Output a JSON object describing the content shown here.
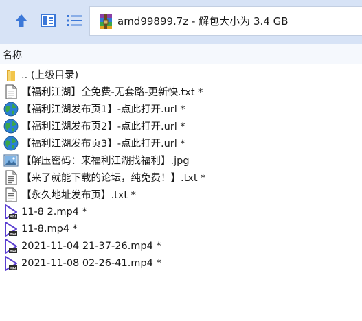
{
  "toolbar": {
    "up_icon": "up-arrow-icon",
    "view_icon": "view-mode-icon",
    "list_icon": "list-view-icon"
  },
  "address": {
    "icon": "winrar-archive-icon",
    "text": "amd99899.7z - 解包大小为 3.4 GB"
  },
  "columns": {
    "name_header": "名称"
  },
  "files": [
    {
      "icon": "folder-icon",
      "name": ".. (上级目录)"
    },
    {
      "icon": "text-file-icon",
      "name": "【福利江湖】全免费-无套路-更新快.txt *"
    },
    {
      "icon": "globe-url-icon",
      "name": "【福利江湖发布页1】-点此打开.url *"
    },
    {
      "icon": "globe-url-icon",
      "name": "【福利江湖发布页2】-点此打开.url *"
    },
    {
      "icon": "globe-url-icon",
      "name": "【福利江湖发布页3】-点此打开.url *"
    },
    {
      "icon": "image-file-icon",
      "name": "【解压密码：来福利江湖找福利】.jpg"
    },
    {
      "icon": "text-file-icon",
      "name": "【来了就能下载的论坛，纯免费！】.txt *"
    },
    {
      "icon": "text-file-icon",
      "name": "【永久地址发布页】.txt *"
    },
    {
      "icon": "video-file-icon",
      "name": "11-8 2.mp4 *"
    },
    {
      "icon": "video-file-icon",
      "name": "11-8.mp4 *"
    },
    {
      "icon": "video-file-icon",
      "name": "2021-11-04 21-37-26.mp4 *"
    },
    {
      "icon": "video-file-icon",
      "name": "2021-11-08 02-26-41.mp4 *"
    }
  ],
  "colors": {
    "toolbar_bg": "#d7e3f6",
    "accent_blue": "#3c78d8",
    "folder_yellow": "#f2c54b",
    "video_purple": "#5b3fd0"
  }
}
